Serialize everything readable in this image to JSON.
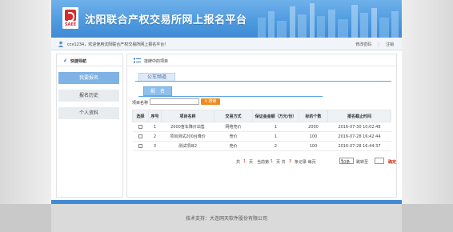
{
  "header": {
    "logo_text": "SAEE",
    "site_title": "沈阳联合产权交易所网上报名平台"
  },
  "userbar": {
    "username": "ccx1234",
    "welcome": "，欢迎使用沈阳联合产权交易所网上报名平台！",
    "change_password": "修改密码",
    "logout": "注销"
  },
  "leftnav": {
    "title": "快捷导航",
    "items": [
      {
        "label": "我要报名",
        "active": true
      },
      {
        "label": "报名历史",
        "active": false
      },
      {
        "label": "个人资料",
        "active": false
      }
    ]
  },
  "main": {
    "title": "挂牌中的项目",
    "tab": "公车频道",
    "subtab": "报　名",
    "search_label": "项目名称",
    "search_value": "",
    "search_button": "搜索",
    "columns": [
      "选择",
      "序号",
      "项目名称",
      "交易方式",
      "保证金金额（万元/份）",
      "标的个数",
      "报名截止时间"
    ],
    "rows": [
      {
        "no": "1",
        "name": "2000奋车降价出售",
        "mode": "网络竞价",
        "deposit": "1",
        "count": "2000",
        "deadline": "2016-07-30 10:02:48"
      },
      {
        "no": "2",
        "name": "项目测试200台降价",
        "mode": "竞价",
        "deposit": "1",
        "count": "100",
        "deadline": "2016-07-28 16:42:44"
      },
      {
        "no": "3",
        "name": "测试项目2",
        "mode": "竞价",
        "deposit": "2",
        "count": "100",
        "deadline": "2016-07-28 16:44:37"
      }
    ],
    "pager": {
      "total_label": "共",
      "total_pages": "1",
      "page_unit": "页",
      "current_label": "当前第",
      "current_page": "1",
      "total_records_label": "页 共",
      "total_records": "3",
      "records_unit": "条记录 每页",
      "page_size": "10条",
      "jump_label": "跳转至",
      "confirm": "确定"
    }
  },
  "footer": {
    "support": "技术支持：大连网天软件股份有限公司"
  },
  "colors": {
    "brand_blue": "#4f9be0",
    "nav_active": "#7fb3e6",
    "search_orange": "#f08a1c",
    "pager_red": "#c8321e"
  }
}
